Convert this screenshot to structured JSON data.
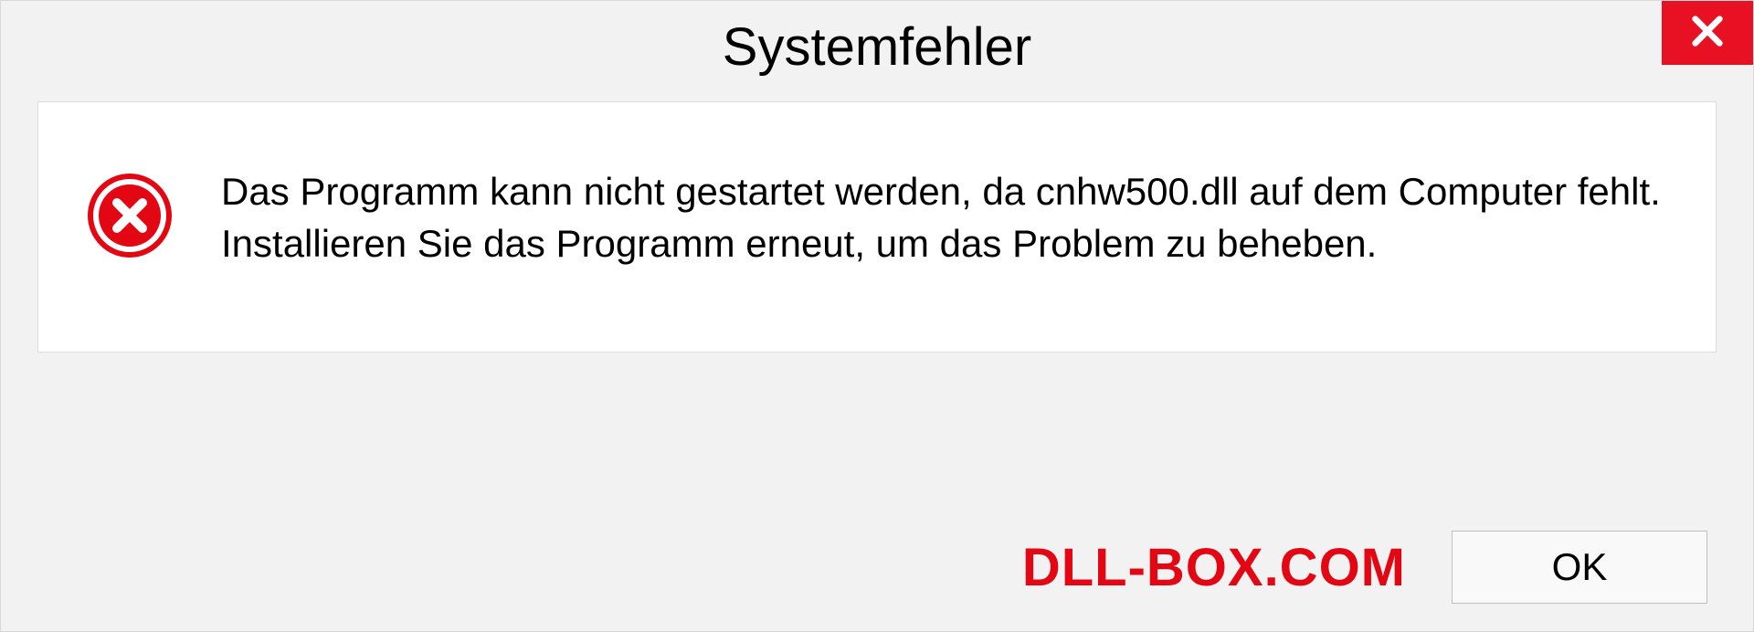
{
  "dialog": {
    "title": "Systemfehler",
    "message": "Das Programm kann nicht gestartet werden, da cnhw500.dll auf dem Computer fehlt. Installieren Sie das Programm erneut, um das Problem zu beheben.",
    "ok_label": "OK"
  },
  "watermark": "DLL-BOX.COM"
}
